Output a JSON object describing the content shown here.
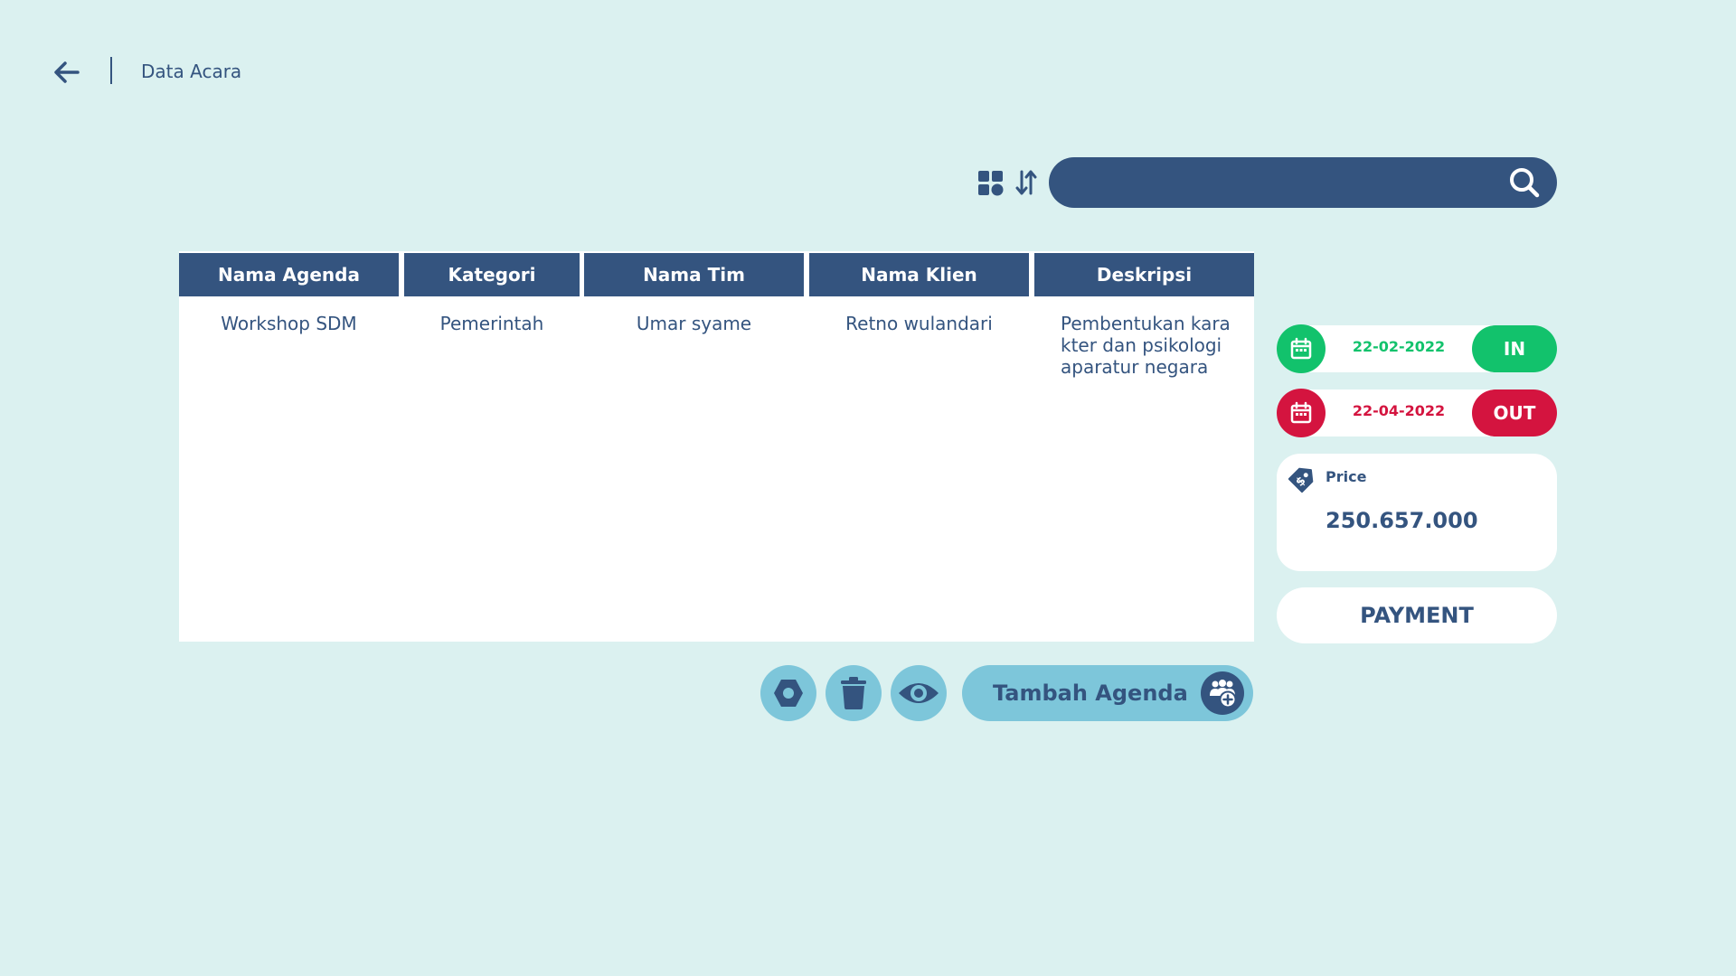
{
  "header": {
    "title": "Data Acara"
  },
  "search": {
    "value": "",
    "placeholder": ""
  },
  "table": {
    "columns": [
      "Nama Agenda",
      "Kategori",
      "Nama Tim",
      "Nama Klien",
      "Deskripsi"
    ],
    "rows": [
      [
        "Workshop SDM",
        "Pemerintah",
        "Umar syame",
        "Retno wulandari",
        "Pembentukan karakter dan psikologi aparatur negara"
      ]
    ]
  },
  "dates": {
    "in": {
      "date": "22-02-2022",
      "label": "IN",
      "color": "#12c26c"
    },
    "out": {
      "date": "22-04-2022",
      "label": "OUT",
      "color": "#d4143f"
    }
  },
  "price": {
    "label": "Price",
    "value": "250.657.000",
    "icon": "price-tag-icon"
  },
  "payment": {
    "label": "PAYMENT"
  },
  "actions": {
    "add_label": "Tambah Agenda",
    "icons": [
      "settings-icon",
      "trash-icon",
      "eye-icon",
      "add-team-icon"
    ]
  },
  "colors": {
    "background": "#dbf1f0",
    "primary": "#34547f",
    "accent": "#7dc6da"
  }
}
